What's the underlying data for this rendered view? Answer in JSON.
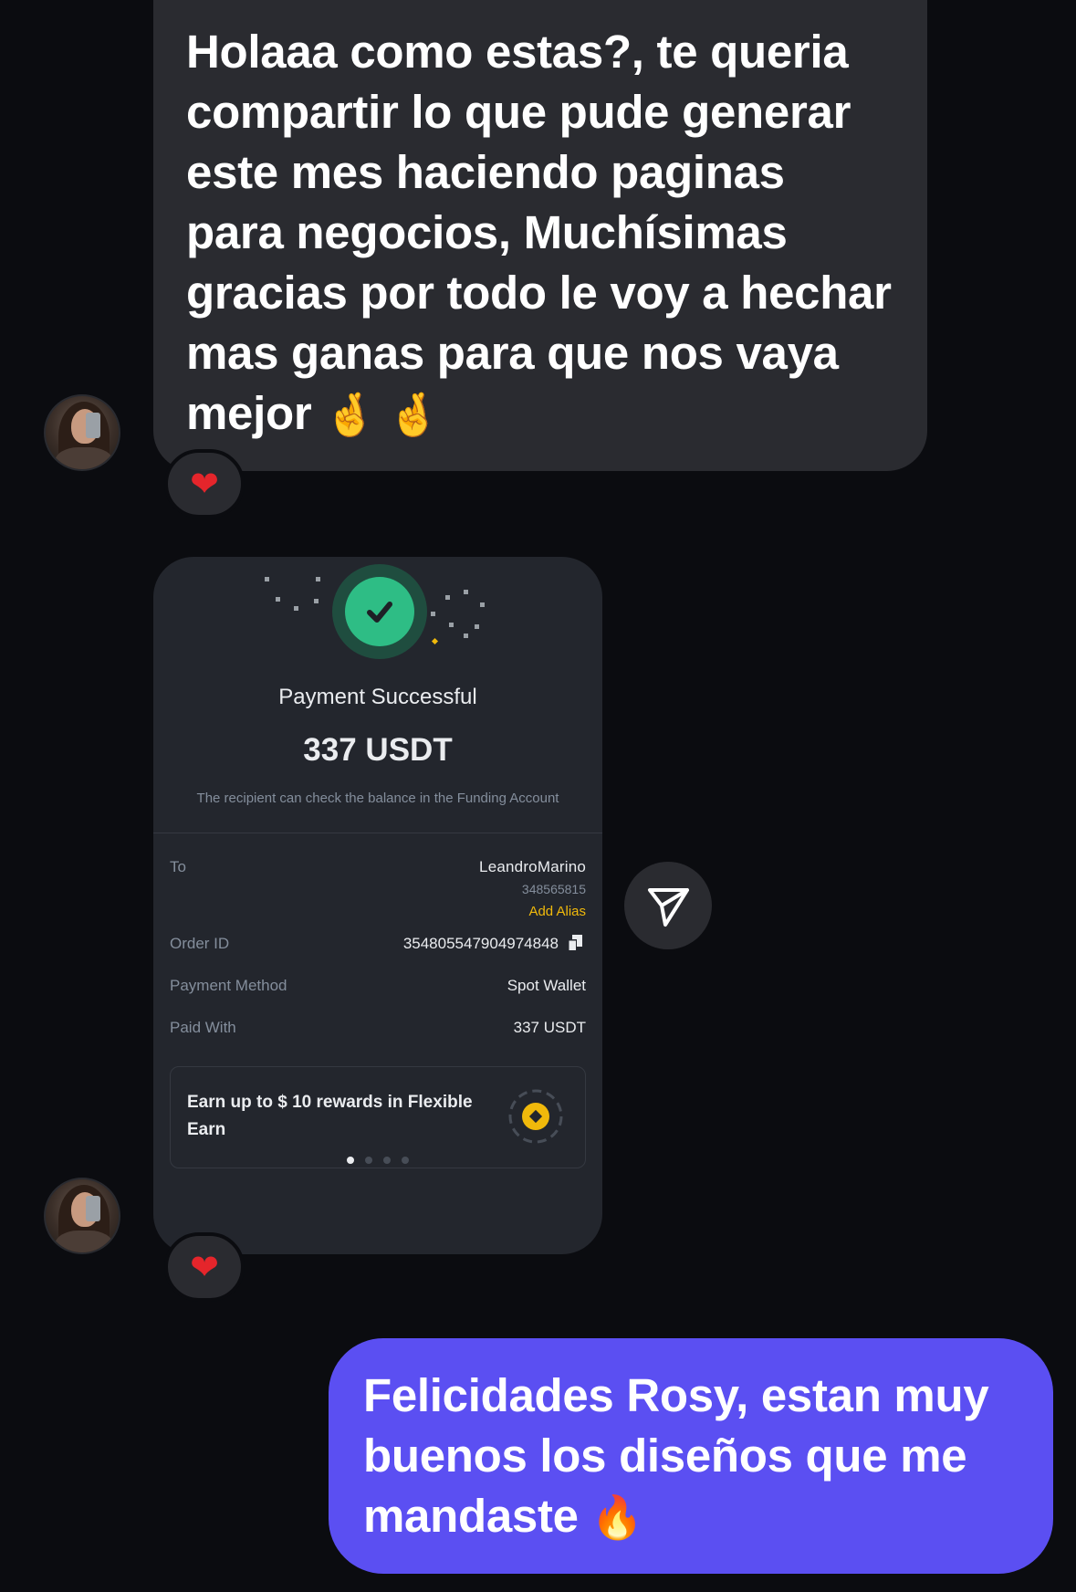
{
  "messages": {
    "incoming_text": "Holaaa como estas?, te queria compartir lo que pude generar este mes haciendo paginas para negocios, Muchísimas gracias por todo le voy a hechar mas ganas para que nos vaya mejor",
    "incoming_emoji": "🤞 🤞",
    "outgoing_text": "Felicidades Rosy, estan muy buenos los diseños que me mandaste",
    "outgoing_emoji": "🔥",
    "reaction_1": "❤",
    "reaction_2": "❤"
  },
  "payment_card": {
    "title": "Payment Successful",
    "amount": "337 USDT",
    "note": "The recipient can check the balance in the Funding Account",
    "to_label": "To",
    "to_name": "LeandroMarino",
    "to_id": "348565815",
    "add_alias": "Add Alias",
    "order_id_label": "Order ID",
    "order_id": "354805547904974848",
    "payment_method_label": "Payment Method",
    "payment_method": "Spot Wallet",
    "paid_with_label": "Paid With",
    "paid_with": "337 USDT",
    "promo_text": "Earn up to $ 10 rewards in Flexible Earn",
    "pager_pages": 4,
    "pager_active": 1
  },
  "icons": {
    "success": "checkmark-icon",
    "copy": "copy-icon",
    "promo": "coin-icon",
    "share": "send-icon",
    "reaction": "heart-icon",
    "avatar": "profile-avatar"
  },
  "colors": {
    "background": "#0b0c10",
    "incoming_bubble": "#2a2b30",
    "outgoing_bubble": "#5b4ff2",
    "card_background": "#23262d",
    "success_green": "#2ebd85",
    "accent_yellow": "#f0b90b"
  }
}
